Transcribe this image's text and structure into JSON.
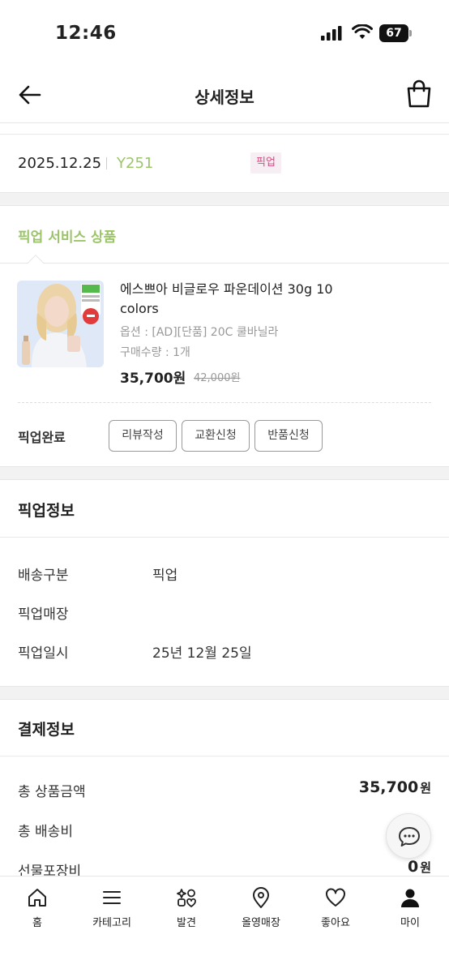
{
  "status_bar": {
    "time": "12:46",
    "battery": "67"
  },
  "header": {
    "title": "상세정보"
  },
  "order": {
    "date": "2025.12.25",
    "number": "Y251",
    "badge": "픽업"
  },
  "pickup_service": {
    "title": "픽업 서비스 상품",
    "product": {
      "name": "에스쁘아 비글로우 파운데이션 30g 10 colors",
      "option": "옵션 : [AD][단품] 20C 쿨바닐라",
      "quantity": "구매수량 : 1개",
      "price": "35,700원",
      "original_price": "42,000원"
    },
    "status": "픽업완료",
    "actions": [
      "리뷰작성",
      "교환신청",
      "반품신청"
    ]
  },
  "pickup_info": {
    "title": "픽업정보",
    "rows": [
      {
        "label": "배송구분",
        "value": "픽업"
      },
      {
        "label": "픽업매장",
        "value": ""
      },
      {
        "label": "픽업일시",
        "value": "25년 12월 25일"
      }
    ]
  },
  "payment_info": {
    "title": "결제정보",
    "rows": [
      {
        "label": "총 상품금액",
        "value": "35,700",
        "unit": "원"
      },
      {
        "label": "총 배송비",
        "value": "",
        "unit": ""
      },
      {
        "label": "선물포장비",
        "value": "0",
        "unit": "원"
      }
    ]
  },
  "bottom_nav": [
    {
      "label": "홈",
      "icon": "home-icon"
    },
    {
      "label": "카테고리",
      "icon": "menu-icon"
    },
    {
      "label": "발견",
      "icon": "discover-icon"
    },
    {
      "label": "올영매장",
      "icon": "location-pin-icon"
    },
    {
      "label": "좋아요",
      "icon": "heart-icon"
    },
    {
      "label": "마이",
      "icon": "person-icon"
    }
  ],
  "colors": {
    "accent_green": "#9cc56a",
    "badge_pink": "#d84a82"
  }
}
